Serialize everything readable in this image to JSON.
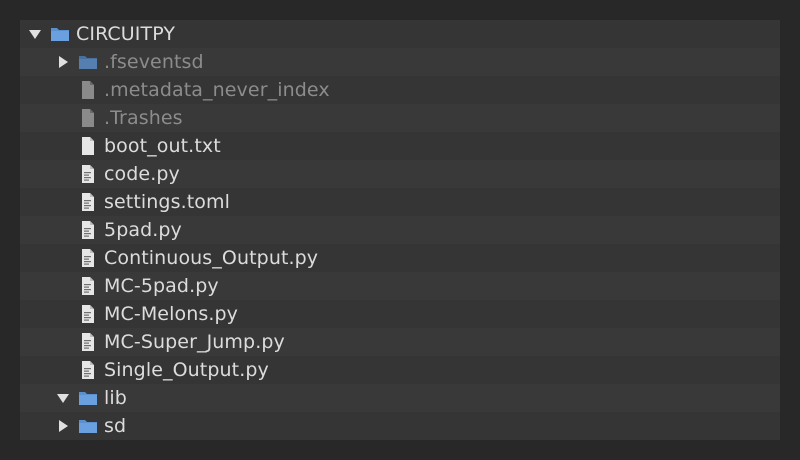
{
  "tree": {
    "root": {
      "label": "CIRCUITPY",
      "expanded": true
    },
    "items": [
      {
        "label": ".fseventsd",
        "kind": "folder",
        "dim": true,
        "expandable": true,
        "expanded": false
      },
      {
        "label": ".metadata_never_index",
        "kind": "file",
        "dim": true
      },
      {
        "label": ".Trashes",
        "kind": "file",
        "dim": true
      },
      {
        "label": "boot_out.txt",
        "kind": "file",
        "dim": false
      },
      {
        "label": "code.py",
        "kind": "code",
        "dim": false
      },
      {
        "label": "settings.toml",
        "kind": "code",
        "dim": false
      },
      {
        "label": "5pad.py",
        "kind": "code",
        "dim": false
      },
      {
        "label": "Continuous_Output.py",
        "kind": "code",
        "dim": false
      },
      {
        "label": "MC-5pad.py",
        "kind": "code",
        "dim": false
      },
      {
        "label": "MC-Melons.py",
        "kind": "code",
        "dim": false
      },
      {
        "label": "MC-Super_Jump.py",
        "kind": "code",
        "dim": false
      },
      {
        "label": "Single_Output.py",
        "kind": "code",
        "dim": false
      },
      {
        "label": "lib",
        "kind": "folder",
        "dim": false,
        "expandable": true,
        "expanded": true
      },
      {
        "label": "sd",
        "kind": "folder",
        "dim": false,
        "expandable": true,
        "expanded": false
      }
    ]
  },
  "colors": {
    "folder": "#5a8fd0",
    "folder_dim": "#47709f",
    "text": "#dcdcdc",
    "text_dim": "#8c8c8c"
  }
}
